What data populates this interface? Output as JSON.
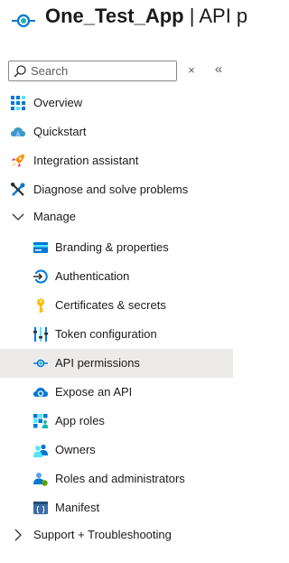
{
  "header": {
    "app_name": "One_Test_App",
    "title_suffix": " | API p"
  },
  "search": {
    "placeholder": "Search"
  },
  "controls": {
    "clear_glyph": "×",
    "collapse_glyph": "«"
  },
  "nav": {
    "overview": "Overview",
    "quickstart": "Quickstart",
    "integration_assistant": "Integration assistant",
    "diagnose": "Diagnose and solve problems",
    "manage": "Manage",
    "manage_items": {
      "branding": "Branding & properties",
      "authentication": "Authentication",
      "certificates": "Certificates & secrets",
      "token_configuration": "Token configuration",
      "api_permissions": "API permissions",
      "expose_api": "Expose an API",
      "app_roles": "App roles",
      "owners": "Owners",
      "roles_admins": "Roles and administrators",
      "manifest": "Manifest"
    },
    "support": "Support + Troubleshooting"
  },
  "state": {
    "selected": "API permissions",
    "manage_expanded": true,
    "support_expanded": false
  },
  "colors": {
    "accent_blue": "#0078d4",
    "accent_teal": "#1fb6a8",
    "selected_bg": "#edebe9",
    "text": "#1b1b1b"
  }
}
